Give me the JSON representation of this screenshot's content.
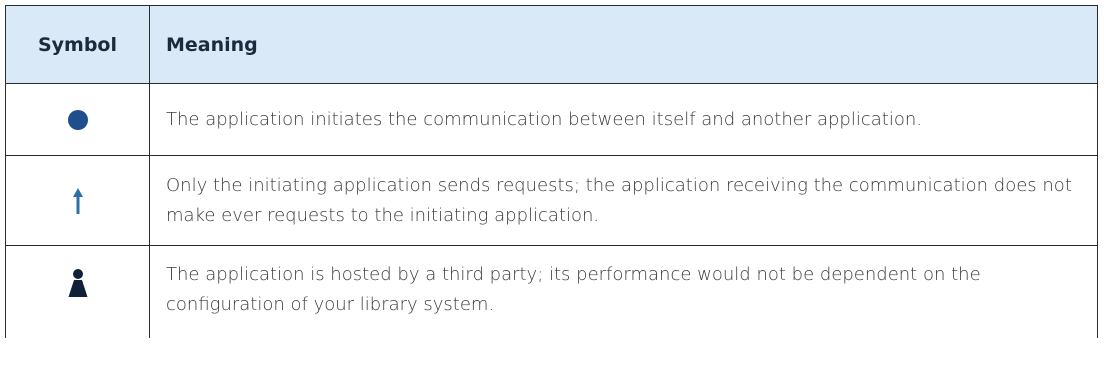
{
  "table": {
    "headers": {
      "symbol": "Symbol",
      "meaning": "Meaning"
    },
    "rows": [
      {
        "icon": "filled-circle",
        "icon_color": "#1e4e8c",
        "meaning": "The application initiates the communication between itself and another application."
      },
      {
        "icon": "up-arrow",
        "icon_color": "#2d6fa6",
        "meaning": "Only the initiating application sends requests; the application receiving the communication does not make ever requests to the initiating application."
      },
      {
        "icon": "person",
        "icon_color": "#0f2038",
        "meaning": "The application is hosted by a third party; its performance would not be dependent on the configuration of your library system."
      }
    ]
  }
}
